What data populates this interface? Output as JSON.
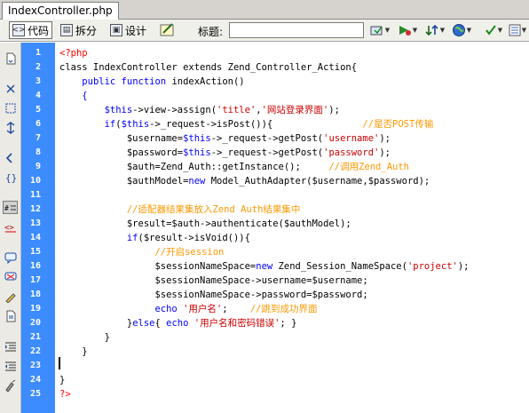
{
  "tab": {
    "filename": "IndexController.php"
  },
  "toolbar": {
    "code_label": "代码",
    "split_label": "拆分",
    "design_label": "设计",
    "title_label": "标题:",
    "title_value": ""
  },
  "line_numbers": [
    "1",
    "2",
    "3",
    "4",
    "5",
    "6",
    "7",
    "8",
    "9",
    "10",
    "11",
    "12",
    "13",
    "14",
    "15",
    "16",
    "17",
    "18",
    "19",
    "20",
    "21",
    "22",
    "23",
    "24",
    "25"
  ],
  "code_lines": [
    [
      [
        "tag",
        "<?php"
      ]
    ],
    [
      [
        "def",
        "class IndexController extends Zend_Controller_Action{"
      ]
    ],
    [
      [
        "def",
        "    "
      ],
      [
        "kw",
        "public function"
      ],
      [
        "def",
        " indexAction()"
      ]
    ],
    [
      [
        "def",
        "    "
      ],
      [
        "kw",
        "{"
      ]
    ],
    [
      [
        "def",
        "        "
      ],
      [
        "var",
        "$this"
      ],
      [
        "def",
        "->view->assign("
      ],
      [
        "str",
        "'title'"
      ],
      [
        "def",
        ","
      ],
      [
        "str",
        "'网站登录界面'"
      ],
      [
        "def",
        ");"
      ]
    ],
    [
      [
        "def",
        "        "
      ],
      [
        "kw",
        "if"
      ],
      [
        "def",
        "("
      ],
      [
        "var",
        "$this"
      ],
      [
        "def",
        "->_request->isPost()){                "
      ],
      [
        "cmt",
        "//是否POST传输"
      ]
    ],
    [
      [
        "def",
        "            $username="
      ],
      [
        "var",
        "$this"
      ],
      [
        "def",
        "->_request->getPost("
      ],
      [
        "str",
        "'username'"
      ],
      [
        "def",
        ");"
      ]
    ],
    [
      [
        "def",
        "            $password="
      ],
      [
        "var",
        "$this"
      ],
      [
        "def",
        "->_request->getPost("
      ],
      [
        "str",
        "'password'"
      ],
      [
        "def",
        ");"
      ]
    ],
    [
      [
        "def",
        "            $auth=Zend_Auth::getInstance();     "
      ],
      [
        "cmt",
        "//调用Zend_Auth"
      ]
    ],
    [
      [
        "def",
        "            $authModel="
      ],
      [
        "kw",
        "new"
      ],
      [
        "def",
        " Model_AuthAdapter($username,$password);"
      ]
    ],
    [
      [
        "def",
        ""
      ]
    ],
    [
      [
        "def",
        "            "
      ],
      [
        "cmt",
        "//适配器结果集放入Zend Auth结果集中"
      ]
    ],
    [
      [
        "def",
        "            $result=$auth->authenticate($authModel);"
      ]
    ],
    [
      [
        "def",
        "            "
      ],
      [
        "kw",
        "if"
      ],
      [
        "def",
        "($result->isVoid()){"
      ]
    ],
    [
      [
        "def",
        "                 "
      ],
      [
        "cmt",
        "//开启session"
      ]
    ],
    [
      [
        "def",
        "                 $sessionNameSpace="
      ],
      [
        "kw",
        "new"
      ],
      [
        "def",
        " Zend_Session_NameSpace("
      ],
      [
        "str",
        "'project'"
      ],
      [
        "def",
        ");"
      ]
    ],
    [
      [
        "def",
        "                 $sessionNameSpace->username=$username;"
      ]
    ],
    [
      [
        "def",
        "                 $sessionNameSpace->password=$password;"
      ]
    ],
    [
      [
        "def",
        "                 "
      ],
      [
        "kw",
        "echo"
      ],
      [
        "def",
        " "
      ],
      [
        "str",
        "'用户名'"
      ],
      [
        "def",
        ";    "
      ],
      [
        "cmt",
        "//跳到成功界面"
      ]
    ],
    [
      [
        "def",
        "            }"
      ],
      [
        "kw",
        "else"
      ],
      [
        "def",
        "{ "
      ],
      [
        "kw",
        "echo"
      ],
      [
        "def",
        " "
      ],
      [
        "str",
        "'用户名和密码错误'"
      ],
      [
        "def",
        "; }"
      ]
    ],
    [
      [
        "def",
        "        }"
      ]
    ],
    [
      [
        "def",
        "    }"
      ]
    ],
    [
      [
        "def",
        ""
      ]
    ],
    [
      [
        "def",
        "}"
      ]
    ],
    [
      [
        "tag",
        "?>"
      ]
    ]
  ]
}
